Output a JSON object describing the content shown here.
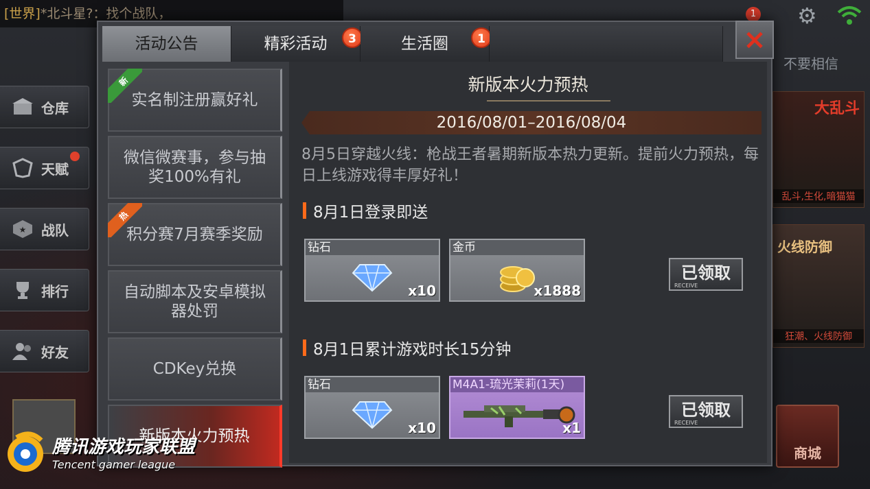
{
  "chat": {
    "channel": "[世界]",
    "message": "*北斗星?：找个战队，"
  },
  "left_menu": [
    {
      "label": "仓库"
    },
    {
      "label": "天赋"
    },
    {
      "label": "战队"
    },
    {
      "label": "排行"
    },
    {
      "label": "好友"
    }
  ],
  "right_side": {
    "notice": "不要相信",
    "card1_title": "大乱斗",
    "card1_sub": "乱斗,生化,暗猫猫",
    "card2_title": "火线防御",
    "card2_sub": "狂潮、火线防御",
    "shop_label": "商城"
  },
  "top": {
    "mail_count": "1"
  },
  "dialog": {
    "tabs": [
      {
        "label": "活动公告",
        "badge": ""
      },
      {
        "label": "精彩活动",
        "badge": "3"
      },
      {
        "label": "生活圈",
        "badge": "1"
      }
    ],
    "close_label": "×",
    "side_items": [
      {
        "label": "实名制注册赢好礼",
        "tag": "新",
        "tag_type": "new"
      },
      {
        "label": "微信微赛事，参与抽奖100%有礼",
        "tag": "",
        "tag_type": ""
      },
      {
        "label": "积分赛7月赛季奖励",
        "tag": "热",
        "tag_type": "hot"
      },
      {
        "label": "自动脚本及安卓模拟器处罚",
        "tag": "",
        "tag_type": ""
      },
      {
        "label": "CDKey兑换",
        "tag": "",
        "tag_type": ""
      },
      {
        "label": "新版本火力预热",
        "tag": "",
        "tag_type": ""
      }
    ],
    "content": {
      "title": "新版本火力预热",
      "date_range": "2016/08/01–2016/08/04",
      "description": "8月5日穿越火线：枪战王者暑期新版本热力更新。提前火力预热，每日上线游戏得丰厚好礼！",
      "sections": [
        {
          "heading": "8月1日登录即送",
          "rewards": [
            {
              "label": "钻石",
              "qty": "x10",
              "icon": "diamond-icon"
            },
            {
              "label": "金币",
              "qty": "x1888",
              "icon": "gold-coins-icon"
            }
          ],
          "button": "已领取",
          "button_sub": "RECEIVE"
        },
        {
          "heading": "8月1日累计游戏时长15分钟",
          "rewards": [
            {
              "label": "钻石",
              "qty": "x10",
              "icon": "diamond-icon"
            },
            {
              "label": "M4A1-琉光茉莉(1天)",
              "qty": "x1",
              "icon": "rifle-icon"
            }
          ],
          "button": "已领取",
          "button_sub": "RECEIVE"
        }
      ]
    }
  },
  "watermark": {
    "title": "腾讯游戏玩家联盟",
    "subtitle": "Tencent gamer league"
  },
  "colors": {
    "accent_red": "#e0301e",
    "tab_active": "#7e8186",
    "highlight": "#c02a20"
  }
}
